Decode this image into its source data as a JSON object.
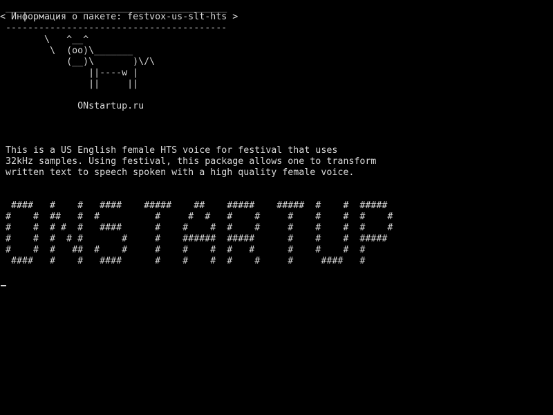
{
  "console": {
    "text_color": "#d9d9d9",
    "background_color": "#000000",
    "cowsay": {
      "border_top": " ________________________________________",
      "message": "< Информация о пакете: festvox-us-slt-hts >",
      "border_bottom": " ----------------------------------------",
      "cow": [
        "        \\   ^__^",
        "         \\  (oo)\\_______",
        "            (__)\\       )\\/\\",
        "                ||----w |",
        "                ||     ||"
      ],
      "site": "              ONstartup.ru"
    },
    "description": [
      " This is a US English female HTS voice for festival that uses",
      " 32kHz samples. Using festival, this package allows one to transform",
      " written text to speech spoken with a high quality female voice."
    ],
    "banner": [
      "  ####   #    #   ####    #####    ##    #####    #####  #    #  #####",
      " #    #  ##   #  #          #     #  #   #    #     #    #    #  #    #",
      " #    #  # #  #   ####      #    #    #  #    #     #    #    #  #    #",
      " #    #  #  # #       #     #    ######  #####      #    #    #  #####",
      " #    #  #   ##  #    #     #    #    #  #   #      #    #    #  #",
      "  ####   #    #   ####      #    #    #  #    #     #     ####   #"
    ]
  }
}
